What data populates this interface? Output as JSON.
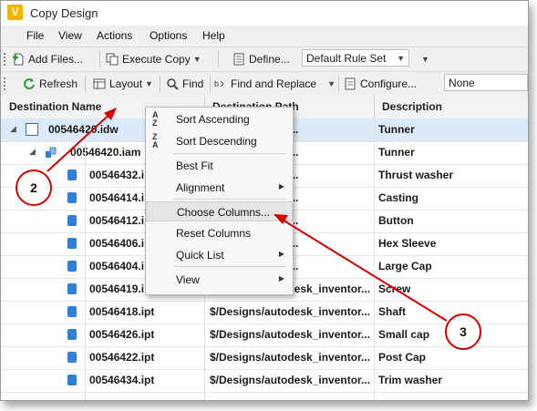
{
  "window": {
    "title": "Copy Design",
    "app_icon": "V"
  },
  "menubar": {
    "items": [
      "File",
      "View",
      "Actions",
      "Options",
      "Help"
    ]
  },
  "toolbar1": {
    "add_files": "Add Files...",
    "execute_copy": "Execute Copy",
    "define": "Define...",
    "rule_set": "Default Rule Set"
  },
  "toolbar2": {
    "refresh": "Refresh",
    "layout": "Layout",
    "find": "Find",
    "find_replace": "Find and Replace",
    "configure": "Configure...",
    "none_combo": "None"
  },
  "grid": {
    "headers": [
      "Destination Name",
      "Destination Path",
      "Description"
    ],
    "rows": [
      {
        "name": "00546420.idw",
        "path": "sdesk_inventor...",
        "desc": "Tunner",
        "type": "drawing"
      },
      {
        "name": "00546420.iam",
        "path": "sdesk_inventor...",
        "desc": "Tunner",
        "type": "assembly"
      },
      {
        "name": "00546432.i",
        "path": "sdesk_inventor...",
        "desc": "Thrust washer",
        "type": "part"
      },
      {
        "name": "00546414.i",
        "path": "sdesk_inventor...",
        "desc": "Casting",
        "type": "part"
      },
      {
        "name": "00546412.i",
        "path": "sdesk_inventor...",
        "desc": "Button",
        "type": "part"
      },
      {
        "name": "00546406.i",
        "path": "sdesk_inventor...",
        "desc": "Hex Sleeve",
        "type": "part"
      },
      {
        "name": "00546404.i",
        "path": "sdesk_inventor...",
        "desc": "Large Cap",
        "type": "part"
      },
      {
        "name": "00546419.i",
        "path": "$/Designs/autodesk_inventor...",
        "desc": "Screw",
        "type": "part"
      },
      {
        "name": "00546418.ipt",
        "path": "$/Designs/autodesk_inventor...",
        "desc": "Shaft",
        "type": "part"
      },
      {
        "name": "00546426.ipt",
        "path": "$/Designs/autodesk_inventor...",
        "desc": "Small cap",
        "type": "part"
      },
      {
        "name": "00546422.ipt",
        "path": "$/Designs/autodesk_inventor...",
        "desc": "Post Cap",
        "type": "part"
      },
      {
        "name": "00546434.ipt",
        "path": "$/Designs/autodesk_inventor...",
        "desc": "Trim washer",
        "type": "part"
      }
    ]
  },
  "context_menu": {
    "sort_ascending": "Sort Ascending",
    "sort_descending": "Sort Descending",
    "best_fit": "Best Fit",
    "alignment": "Alignment",
    "choose_columns": "Choose Columns...",
    "reset_columns": "Reset Columns",
    "quick_list": "Quick List",
    "view": "View"
  },
  "callouts": [
    "2",
    "3"
  ],
  "colors": {
    "accent": "#d40000",
    "selection": "#dbeaf8",
    "part_icon": "#2f7fd8"
  }
}
